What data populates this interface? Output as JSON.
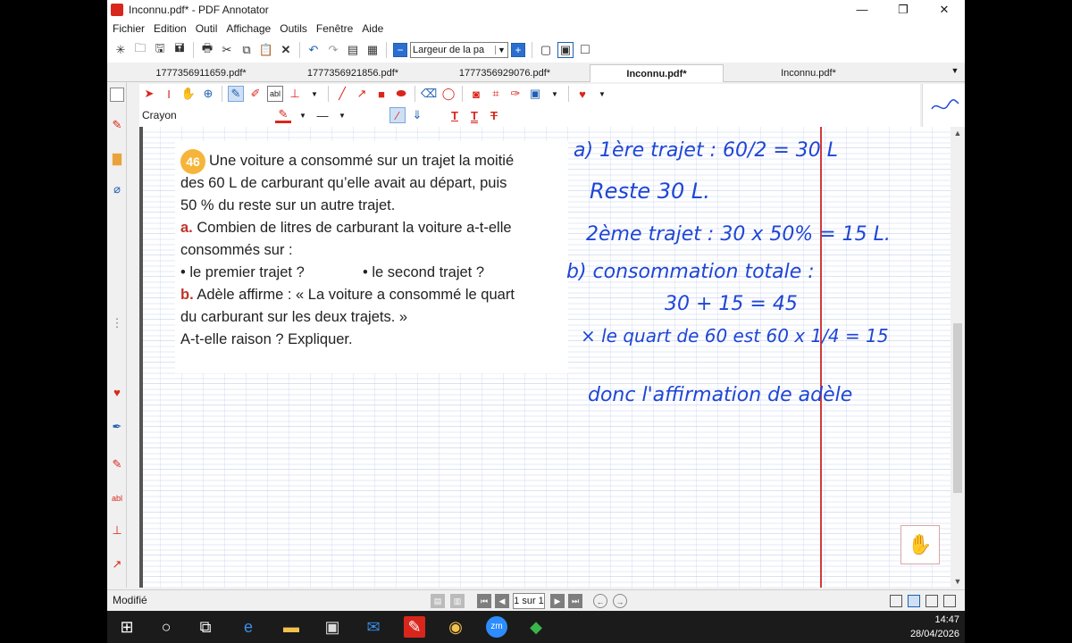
{
  "window": {
    "title": "Inconnu.pdf* - PDF Annotator",
    "minimize": "—",
    "restore": "❐",
    "close": "✕"
  },
  "menu": [
    "Fichier",
    "Edition",
    "Outil",
    "Affichage",
    "Outils",
    "Fenêtre",
    "Aide"
  ],
  "toolbar": {
    "zoom_value": "Largeur de la pa"
  },
  "tabs": [
    {
      "label": "1777356911659.pdf*",
      "active": false
    },
    {
      "label": "1777356921856.pdf*",
      "active": false
    },
    {
      "label": "1777356929076.pdf*",
      "active": false
    },
    {
      "label": "Inconnu.pdf*",
      "active": true
    },
    {
      "label": "Inconnu.pdf*",
      "active": false
    }
  ],
  "annotation_toolbar": {
    "current_tool": "Crayon"
  },
  "exercise": {
    "number": "46",
    "lines": [
      "Une voiture a consommé sur un trajet la moitié",
      "des 60 L de carburant qu’elle avait au départ, puis",
      "50 % du reste sur un autre trajet."
    ],
    "a_label": "a.",
    "a_text": "Combien de litres de carburant la voiture a-t-elle",
    "a_text2": "consommés sur :",
    "bullet1": "• le premier trajet ?",
    "bullet2": "• le second trajet ?",
    "b_label": "b.",
    "b_text": "Adèle affirme : « La voiture a consommé le quart",
    "b_text2": "du carburant sur les deux trajets. »",
    "b_text3": "A-t-elle raison ? Expliquer."
  },
  "handwriting": [
    "a) 1ère trajet : 60/2 = 30 L",
    "Reste 30 L.",
    "2ème trajet : 30 x 50% = 15 L.",
    "b) consommation totale :",
    "30 + 15 = 45",
    "× le quart de 60 est 60 x 1/4 = 15",
    "donc l'affirmation de adèle"
  ],
  "status": {
    "state": "Modifié",
    "page_indicator": "1 sur 1"
  },
  "taskbar": {
    "time": "14:47",
    "date": "28/04/2026"
  },
  "colors": {
    "accent_blue": "#2a6fd0",
    "ink_blue": "#1f46d6",
    "margin_red": "#d33a3a",
    "exercise_badge": "#f6b53a",
    "bold_red": "#c0332b"
  }
}
